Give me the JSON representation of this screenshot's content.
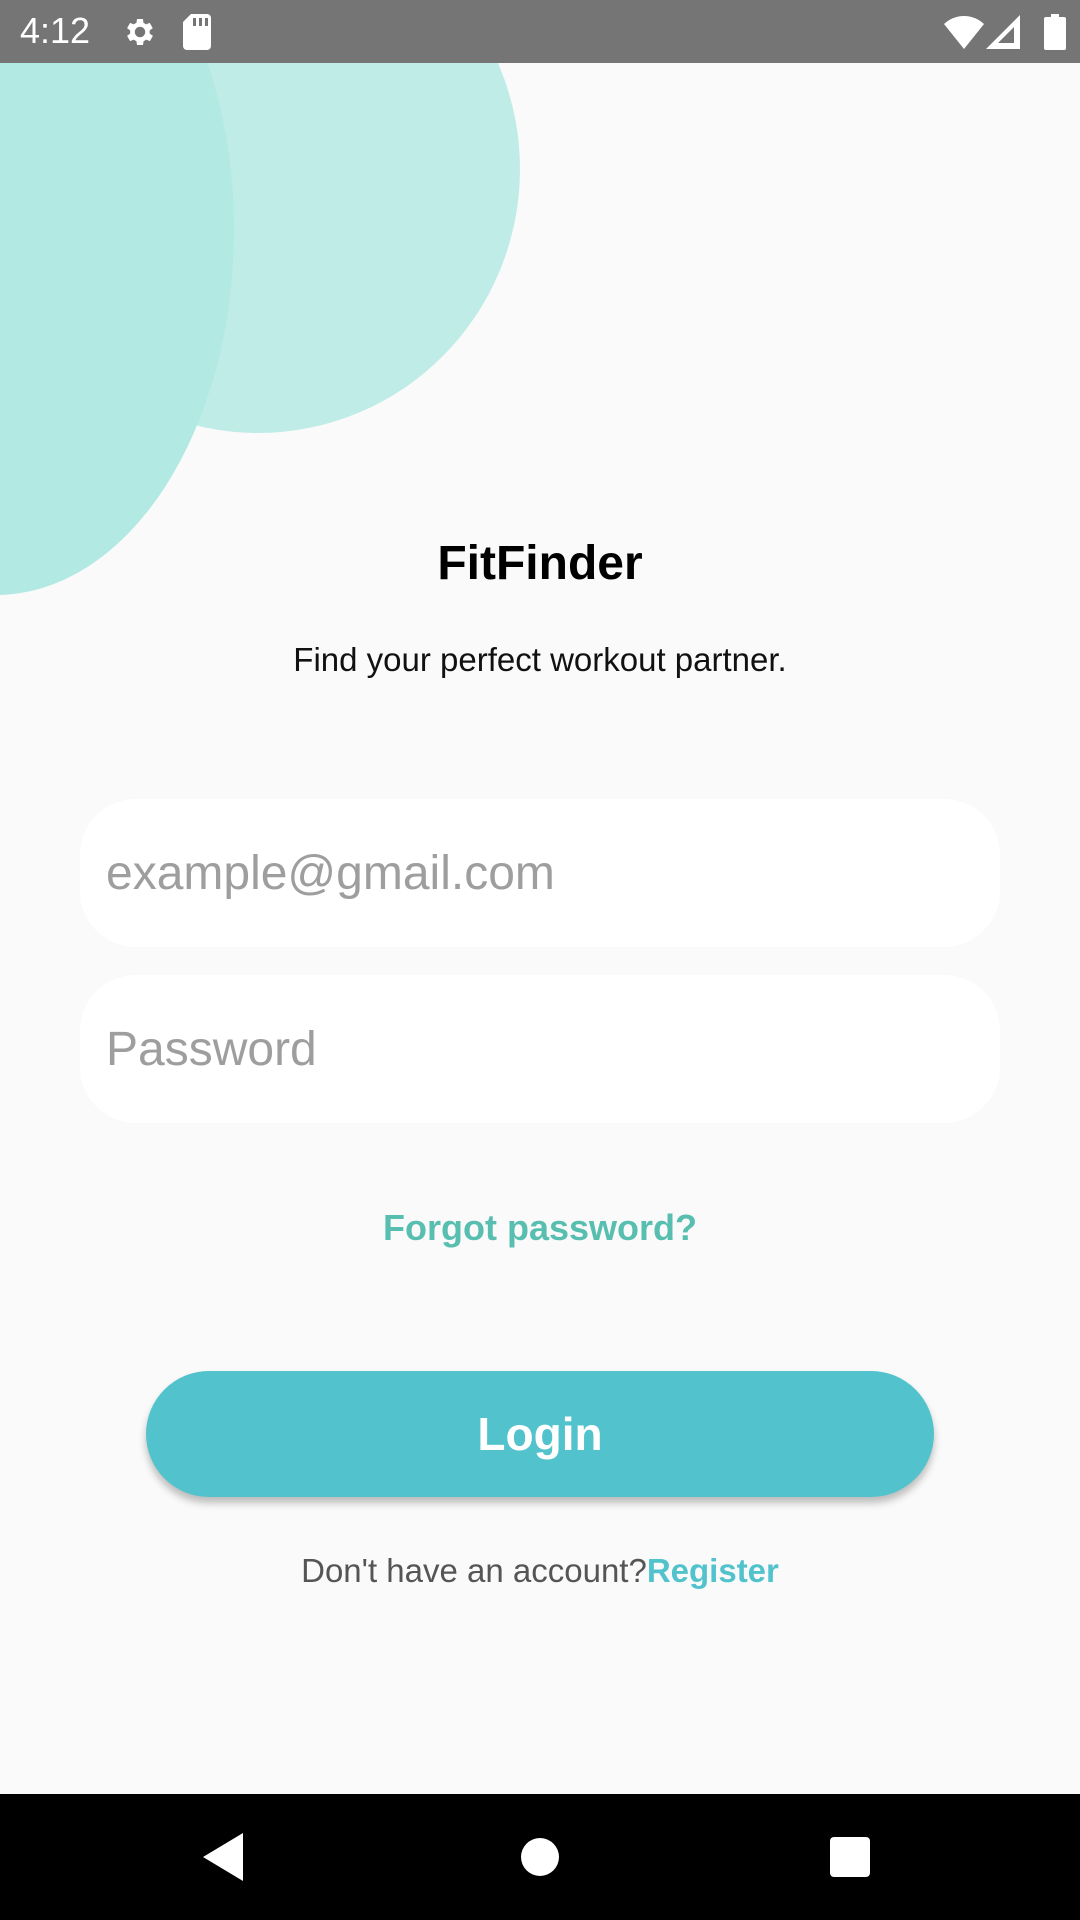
{
  "status_bar": {
    "time": "4:12",
    "icons": [
      "gear-icon",
      "sd-card-icon",
      "wifi-icon",
      "signal-icon",
      "battery-icon"
    ]
  },
  "app": {
    "title": "FitFinder",
    "subtitle": "Find your perfect workout partner."
  },
  "form": {
    "email_placeholder": "example@gmail.com",
    "password_placeholder": "Password",
    "forgot_label": "Forgot password?",
    "login_label": "Login",
    "register_prompt": "Don't have an account?",
    "register_label": "Register"
  },
  "nav_bar": {
    "icons": [
      "back-icon",
      "home-icon",
      "recents-icon"
    ]
  },
  "colors": {
    "accent": "#52c3cc",
    "forgot": "#58bfb0",
    "circle_a": "#b3e9e3",
    "circle_b": "#bfece7",
    "background": "#fafafa",
    "status_bar": "#757575"
  }
}
